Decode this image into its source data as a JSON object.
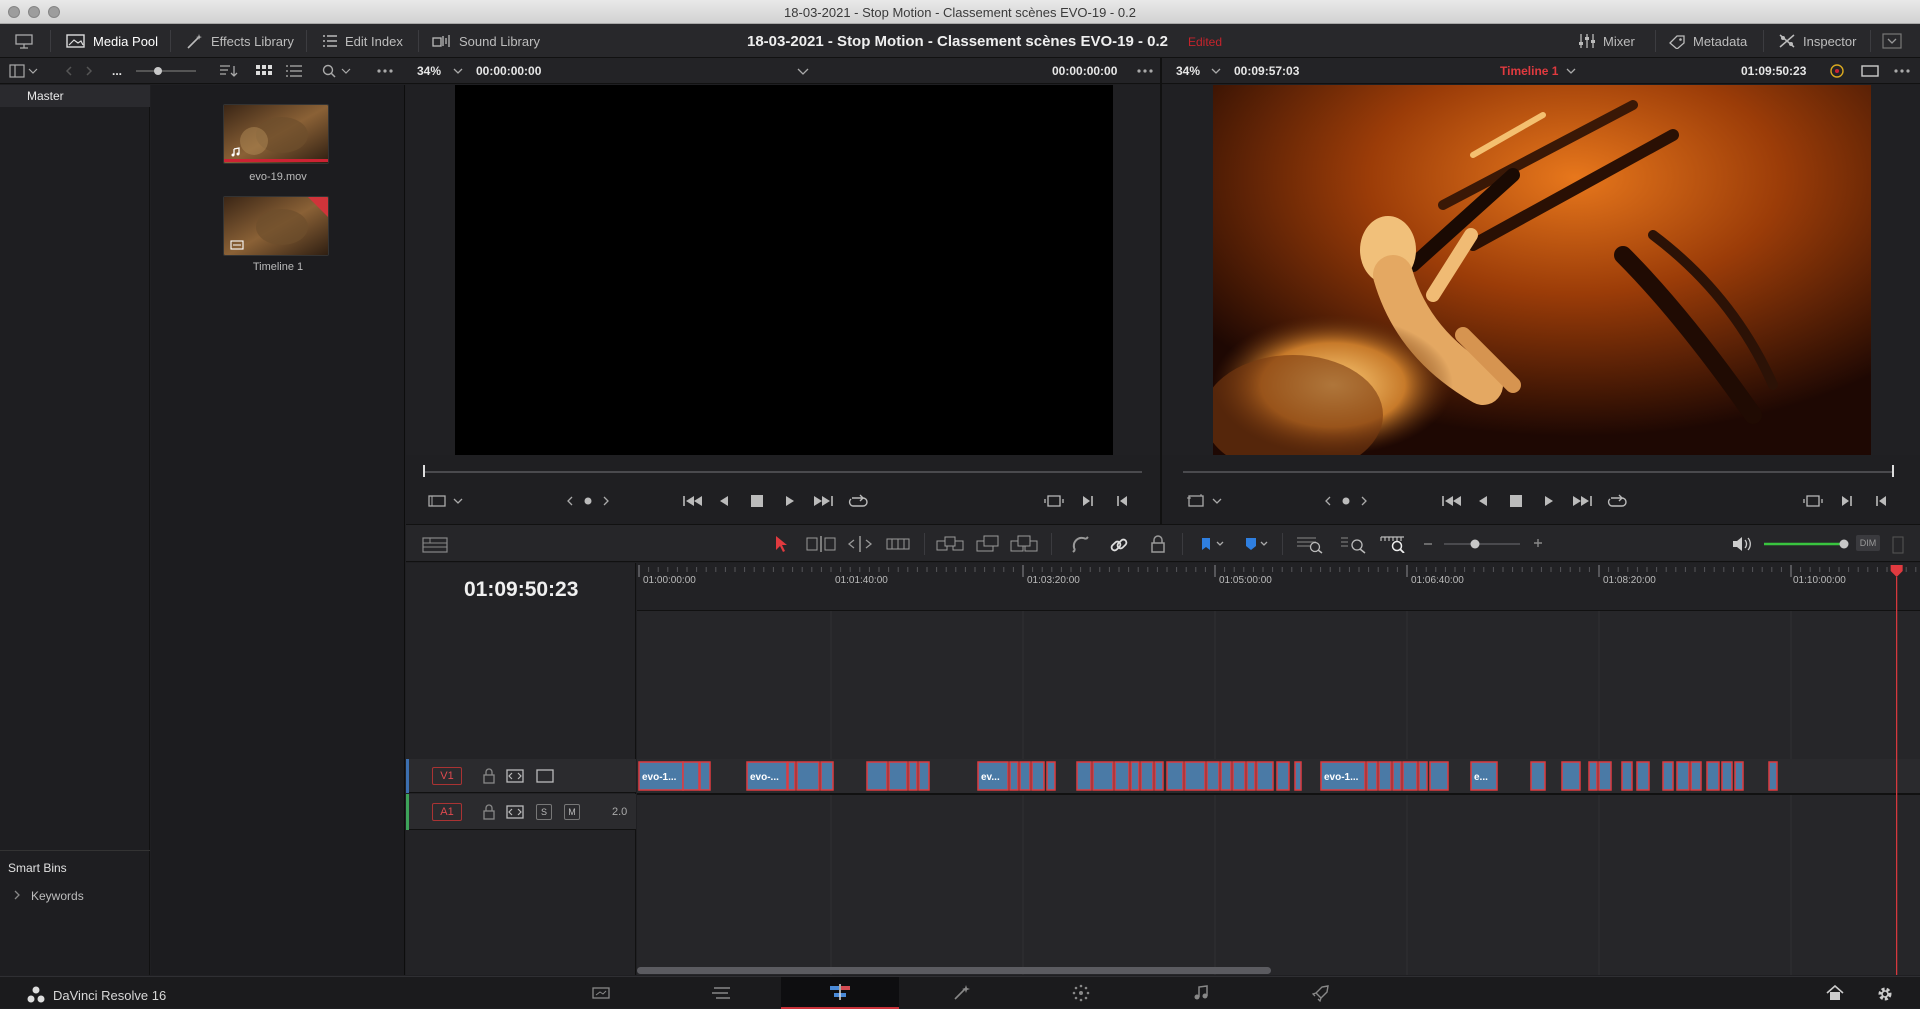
{
  "window_title": "18-03-2021 - Stop Motion - Classement  scènes EVO-19 - 0.2",
  "header": {
    "media_pool": "Media Pool",
    "effects_library": "Effects Library",
    "edit_index": "Edit Index",
    "sound_library": "Sound Library",
    "project_title": "18-03-2021 - Stop Motion - Classement  scènes EVO-19 - 0.2",
    "edited": "Edited",
    "mixer": "Mixer",
    "metadata": "Metadata",
    "inspector": "Inspector"
  },
  "subbar": {
    "ellipsis": "...",
    "source_zoom": "34%",
    "source_tc_left": "00:00:00:00",
    "source_tc_right": "00:00:00:00",
    "timeline_zoom": "34%",
    "timeline_duration": "00:09:57:03",
    "timeline_name": "Timeline 1",
    "timeline_tc": "01:09:50:23"
  },
  "bins": {
    "master": "Master",
    "smart_bins": "Smart Bins",
    "keywords": "Keywords"
  },
  "media": [
    {
      "name": "evo-19.mov"
    },
    {
      "name": "Timeline 1"
    }
  ],
  "timeline": {
    "timecode": "01:09:50:23",
    "ruler_labels": [
      "01:00:00:00",
      "01:01:40:00",
      "01:03:20:00",
      "01:05:00:00",
      "01:06:40:00",
      "01:08:20:00",
      "01:10:00:00"
    ],
    "playhead_fraction": 0.9818,
    "tracks": {
      "video": "V1",
      "audio": "A1",
      "audio_channels": "2.0",
      "solo": "S",
      "mute": "M"
    },
    "clip_labels": [
      "evo-1...",
      "evo-...",
      "ev...",
      "evo-1...",
      "e..."
    ],
    "dim": "DIM"
  },
  "footer": {
    "app_name": "DaVinci Resolve 16"
  },
  "colors": {
    "accent_red": "#e03a3f",
    "clip_blue": "#4a7aa6",
    "volume_green": "#39c43f"
  }
}
